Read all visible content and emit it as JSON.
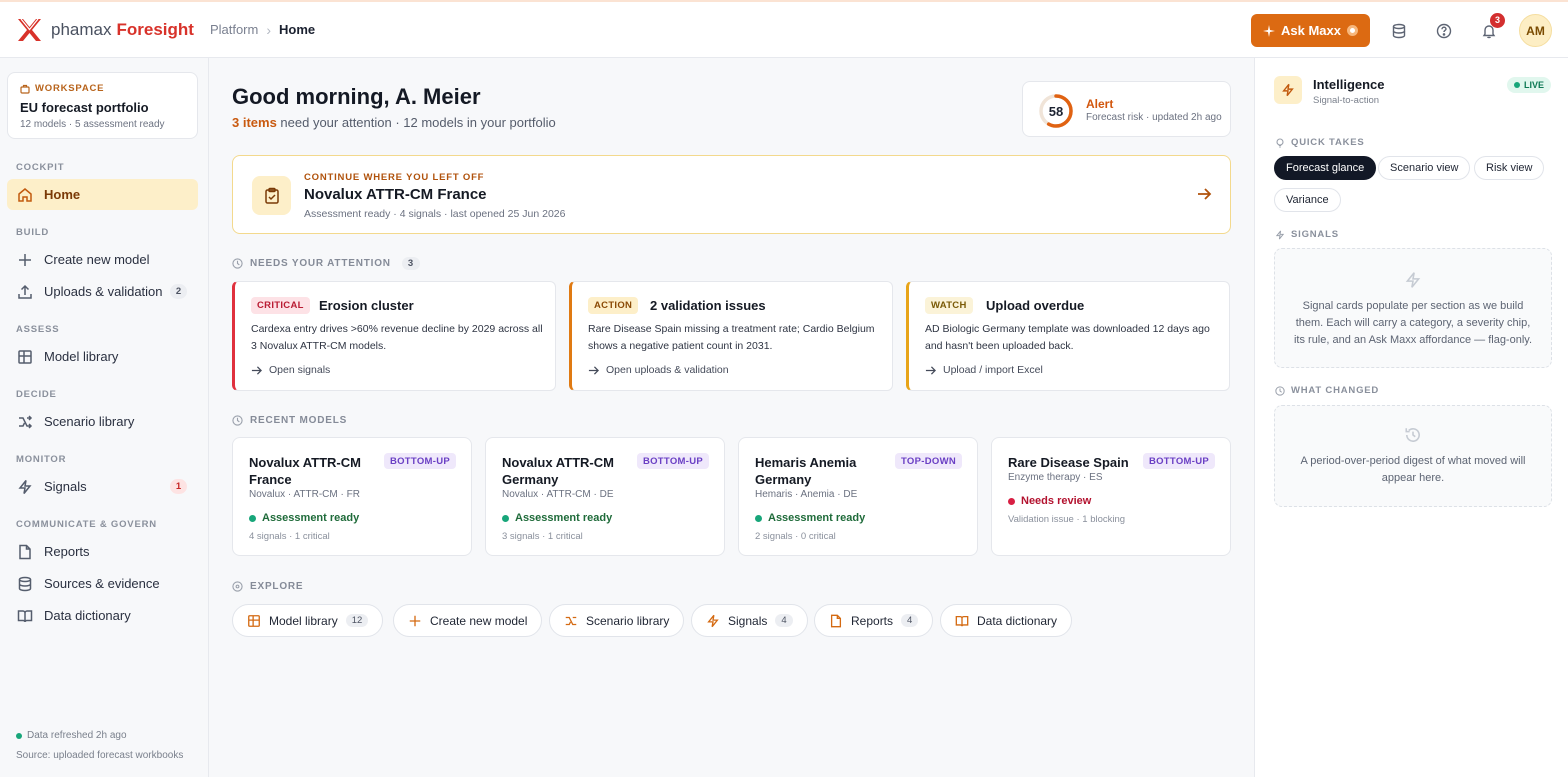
{
  "topbar": {
    "brand_name": "phamax",
    "brand_product": "Foresight",
    "breadcrumb_root": "Platform",
    "breadcrumb_current": "Home",
    "ask_label": "Ask Maxx",
    "notification_count": "3",
    "avatar_initials": "AM"
  },
  "workspace": {
    "label": "WORKSPACE",
    "name": "EU forecast portfolio",
    "meta": "12 models · 5 assessment ready"
  },
  "sidebar": {
    "sections": {
      "cockpit": "COCKPIT",
      "build": "BUILD",
      "assess": "ASSESS",
      "decide": "DECIDE",
      "monitor": "MONITOR",
      "communicate": "COMMUNICATE & GOVERN"
    },
    "items": {
      "home": "Home",
      "create": "Create new model",
      "uploads": "Uploads & validation",
      "uploads_count": "2",
      "library": "Model library",
      "scenario": "Scenario library",
      "signals": "Signals",
      "signals_count": "1",
      "reports": "Reports",
      "sources": "Sources & evidence",
      "dictionary": "Data dictionary"
    },
    "footer": {
      "refreshed": "Data refreshed 2h ago",
      "source": "Source: uploaded forecast workbooks"
    }
  },
  "main": {
    "greeting": "Good morning, A. Meier",
    "attention_items": "3 items",
    "subline_rest": " need your attention · 12 models in your portfolio",
    "alert": {
      "score": "58",
      "score_fraction": 0.58,
      "title": "Alert",
      "meta": "Forecast risk · updated 2h ago"
    },
    "continue": {
      "kicker": "CONTINUE WHERE YOU LEFT OFF",
      "title": "Novalux ATTR-CM France",
      "meta": "Assessment ready · 4 signals · last opened 25 Jun 2026"
    },
    "attention": {
      "heading": "NEEDS YOUR ATTENTION",
      "count": "3",
      "cards": [
        {
          "badge": "CRITICAL",
          "title": "Erosion cluster",
          "desc": "Cardexa entry drives >60% revenue decline by 2029 across all 3 Novalux ATTR-CM models.",
          "link": "Open signals"
        },
        {
          "badge": "ACTION",
          "title": "2 validation issues",
          "desc": "Rare Disease Spain missing a treatment rate; Cardio Belgium shows a negative patient count in 2031.",
          "link": "Open uploads & validation"
        },
        {
          "badge": "WATCH",
          "title": "Upload overdue",
          "desc": "AD Biologic Germany template was downloaded 12 days ago and hasn't been uploaded back.",
          "link": "Upload / import Excel"
        }
      ]
    },
    "recent": {
      "heading": "RECENT MODELS",
      "models": [
        {
          "title": "Novalux ATTR-CM France",
          "badge": "BOTTOM-UP",
          "meta": "Novalux · ATTR-CM · FR",
          "status": "Assessment ready",
          "foot": "4 signals · 1 critical"
        },
        {
          "title": "Novalux ATTR-CM Germany",
          "badge": "BOTTOM-UP",
          "meta": "Novalux · ATTR-CM · DE",
          "status": "Assessment ready",
          "foot": "3 signals · 1 critical"
        },
        {
          "title": "Hemaris Anemia Germany",
          "badge": "TOP-DOWN",
          "meta": "Hemaris · Anemia · DE",
          "status": "Assessment ready",
          "foot": "2 signals · 0 critical"
        },
        {
          "title": "Rare Disease Spain",
          "badge": "BOTTOM-UP",
          "meta": "Enzyme therapy · ES",
          "status": "Needs review",
          "foot": "Validation issue · 1 blocking"
        }
      ]
    },
    "explore": {
      "heading": "EXPLORE",
      "chips": [
        {
          "label": "Model library",
          "count": "12"
        },
        {
          "label": "Create new model",
          "count": ""
        },
        {
          "label": "Scenario library",
          "count": ""
        },
        {
          "label": "Signals",
          "count": "4"
        },
        {
          "label": "Reports",
          "count": "4"
        },
        {
          "label": "Data dictionary",
          "count": ""
        }
      ]
    }
  },
  "panel": {
    "title": "Intelligence",
    "subtitle": "Signal-to-action",
    "live": "LIVE",
    "quick_takes_heading": "QUICK TAKES",
    "takes": [
      "Forecast glance",
      "Scenario view",
      "Risk view",
      "Variance"
    ],
    "signals_heading": "SIGNALS",
    "signals_empty": "Signal cards populate per section as we build them. Each will carry a category, a severity chip, its rule, and an Ask Maxx affordance — flag-only.",
    "changed_heading": "WHAT CHANGED",
    "changed_empty": "A period-over-period digest of what moved will appear here."
  },
  "colors": {
    "accent": "#dc6a12",
    "brand_red": "#d8322a",
    "critical": "#e0303d",
    "ok": "#18a67a"
  }
}
